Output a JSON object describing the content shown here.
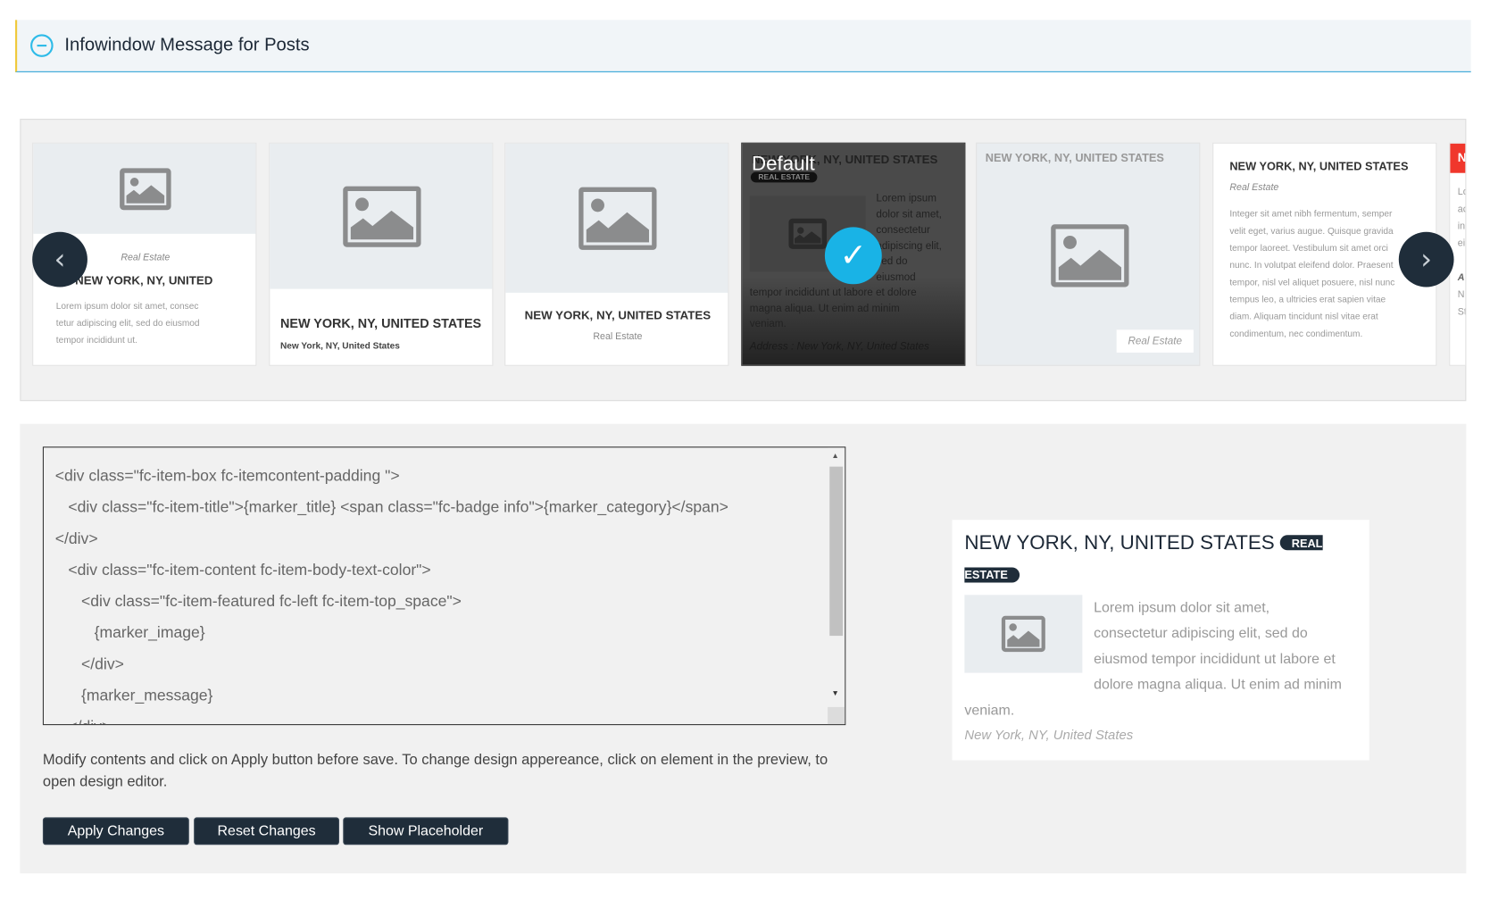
{
  "header": {
    "title": "Infowindow Message for Posts",
    "icon": "minus-circle-icon",
    "accent": "#2ebbe8"
  },
  "carousel": {
    "prev_icon": "chevron-left-icon",
    "next_icon": "chevron-right-icon",
    "cards": [
      {
        "category": "Real Estate",
        "title": "NEW YORK, NY, UNITED",
        "text": [
          "Lorem ipsum dolor sit amet, consec",
          "tetur adipiscing elit, sed do eiusmod",
          "tempor incididunt ut."
        ]
      },
      {
        "title": "NEW YORK, NY, UNITED STATES",
        "subtitle": "New York, NY, United States"
      },
      {
        "title": "NEW YORK, NY, UNITED STATES",
        "category": "Real Estate"
      },
      {
        "overlay_label": "Default",
        "title": "NEW YORK, NY, UNITED STATES",
        "badge": "REAL ESTATE",
        "text_side": [
          "Lorem ipsum",
          "dolor sit amet,",
          "consectetur",
          "adipiscing elit,",
          "sed do",
          "eiusmod"
        ],
        "text_full": [
          "tempor incididunt ut labore et dolore",
          "magna aliqua. Ut enim ad minim",
          "veniam."
        ],
        "address": "Address : New York, NY, United States",
        "selected": true
      },
      {
        "title": "NEW YORK, NY, UNITED STATES",
        "category": "Real Estate"
      },
      {
        "title": "NEW YORK, NY, UNITED STATES",
        "category": "Real Estate",
        "text": [
          "Integer sit amet nibh fermentum, semper",
          "velit eget, varius augue. Quisque gravida",
          "tempor laoreet. Vestibulum sit amet orci",
          "nunc. In volutpat eleifend dolor. Praesent",
          "tempor, nisl vel aliquet posuere, nisl nunc",
          "tempus leo, a ultricies erat sapien vitae",
          "diam. Aliquam tincidunt nisl vitae erat",
          "condimentum, nec condimentum."
        ]
      },
      {
        "title": "N",
        "text": [
          "Lo",
          "ac",
          "in",
          "ei"
        ],
        "bold": "A",
        "text2": [
          "N",
          "St"
        ]
      }
    ]
  },
  "editor": {
    "lines": [
      "<div class=\"fc-item-box fc-itemcontent-padding \">",
      "   <div class=\"fc-item-title\">{marker_title} <span class=\"fc-badge info\">{marker_category}</span>",
      "</div>",
      "   <div class=\"fc-item-content fc-item-body-text-color\">",
      "      <div class=\"fc-item-featured fc-left fc-item-top_space\">",
      "         {marker_image}",
      "      </div>",
      "      {marker_message}",
      "   </div>"
    ]
  },
  "help_text": "Modify contents and click on Apply button before save. To change design appereance, click on element in the preview, to open design editor.",
  "buttons": {
    "apply": "Apply Changes",
    "reset": "Reset Changes",
    "placeholder": "Show Placeholder"
  },
  "preview": {
    "title": "NEW YORK, NY, UNITED STATES",
    "badge_1": "REAL",
    "badge_2": "ESTATE",
    "message": "Lorem ipsum dolor sit amet, consectetur adipiscing elit, sed do eiusmod tempor incididunt ut labore et dolore magna aliqua. Ut enim ad minim veniam.",
    "address": "New York, NY, United States"
  }
}
